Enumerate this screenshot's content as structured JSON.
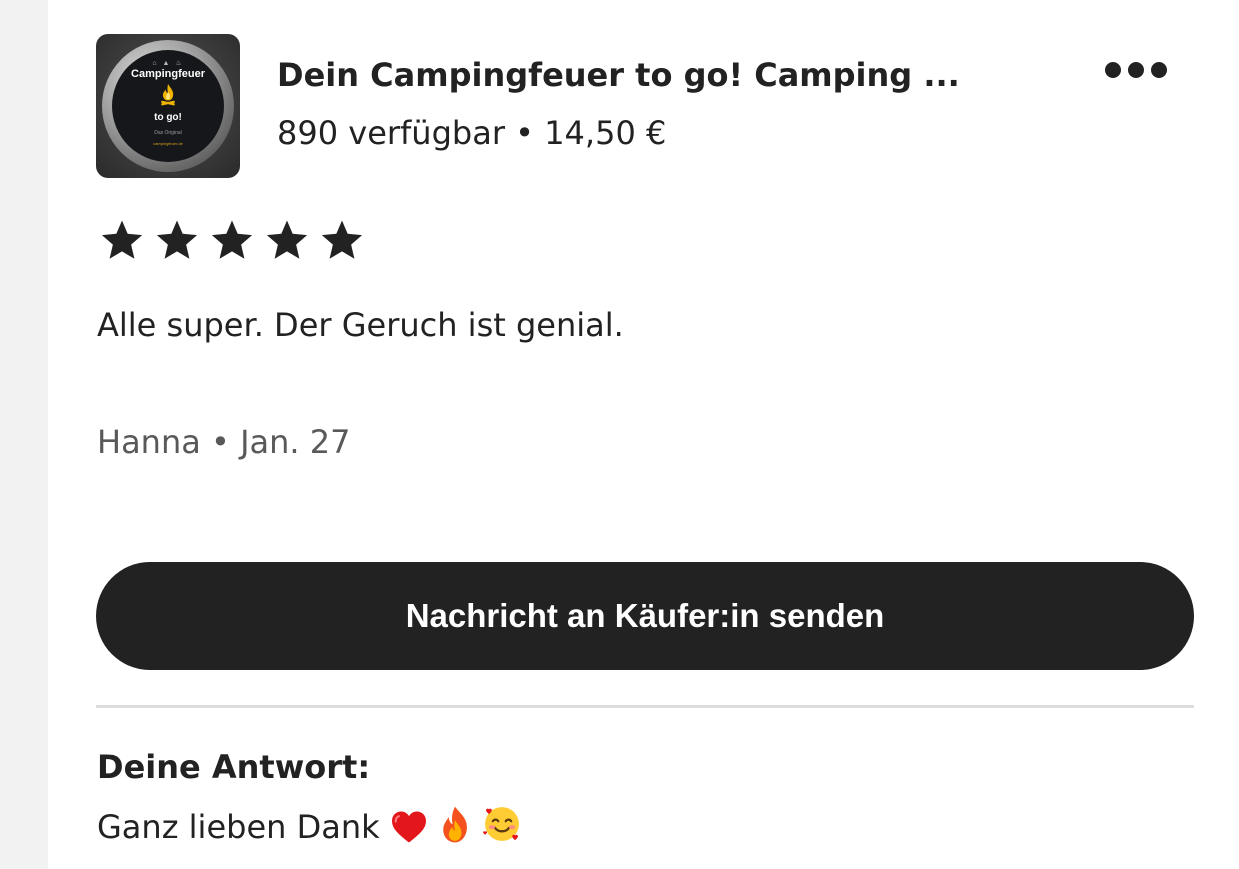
{
  "product": {
    "image_alt": "Campingfeuer to go product tin",
    "image_text": {
      "line1": "Campingfeuer",
      "line2": "to go!",
      "line3": "Das Original",
      "line4": "campingfeuer.de"
    },
    "title": "Dein Campingfeuer to go! Camping ...",
    "availability": "890 verfügbar",
    "separator": "•",
    "price": "14,50 €"
  },
  "menu": {
    "icon": "more-horizontal-icon"
  },
  "review": {
    "rating": 5,
    "rating_max": 5,
    "text": "Alle super. Der Geruch ist genial.",
    "author": "Hanna",
    "separator": "•",
    "date": "Jan. 27"
  },
  "actions": {
    "message_buyer_label": "Nachricht an Käufer:in senden"
  },
  "answer": {
    "heading": "Deine Antwort:",
    "text": "Ganz lieben Dank",
    "emojis": [
      "red-heart-emoji",
      "fire-emoji",
      "smiling-face-with-hearts-emoji"
    ]
  },
  "colors": {
    "text_primary": "#222222",
    "text_secondary": "#595959",
    "button_bg": "#222222",
    "button_text": "#ffffff",
    "divider": "#dddddd",
    "left_strip": "#f2f2f2"
  }
}
